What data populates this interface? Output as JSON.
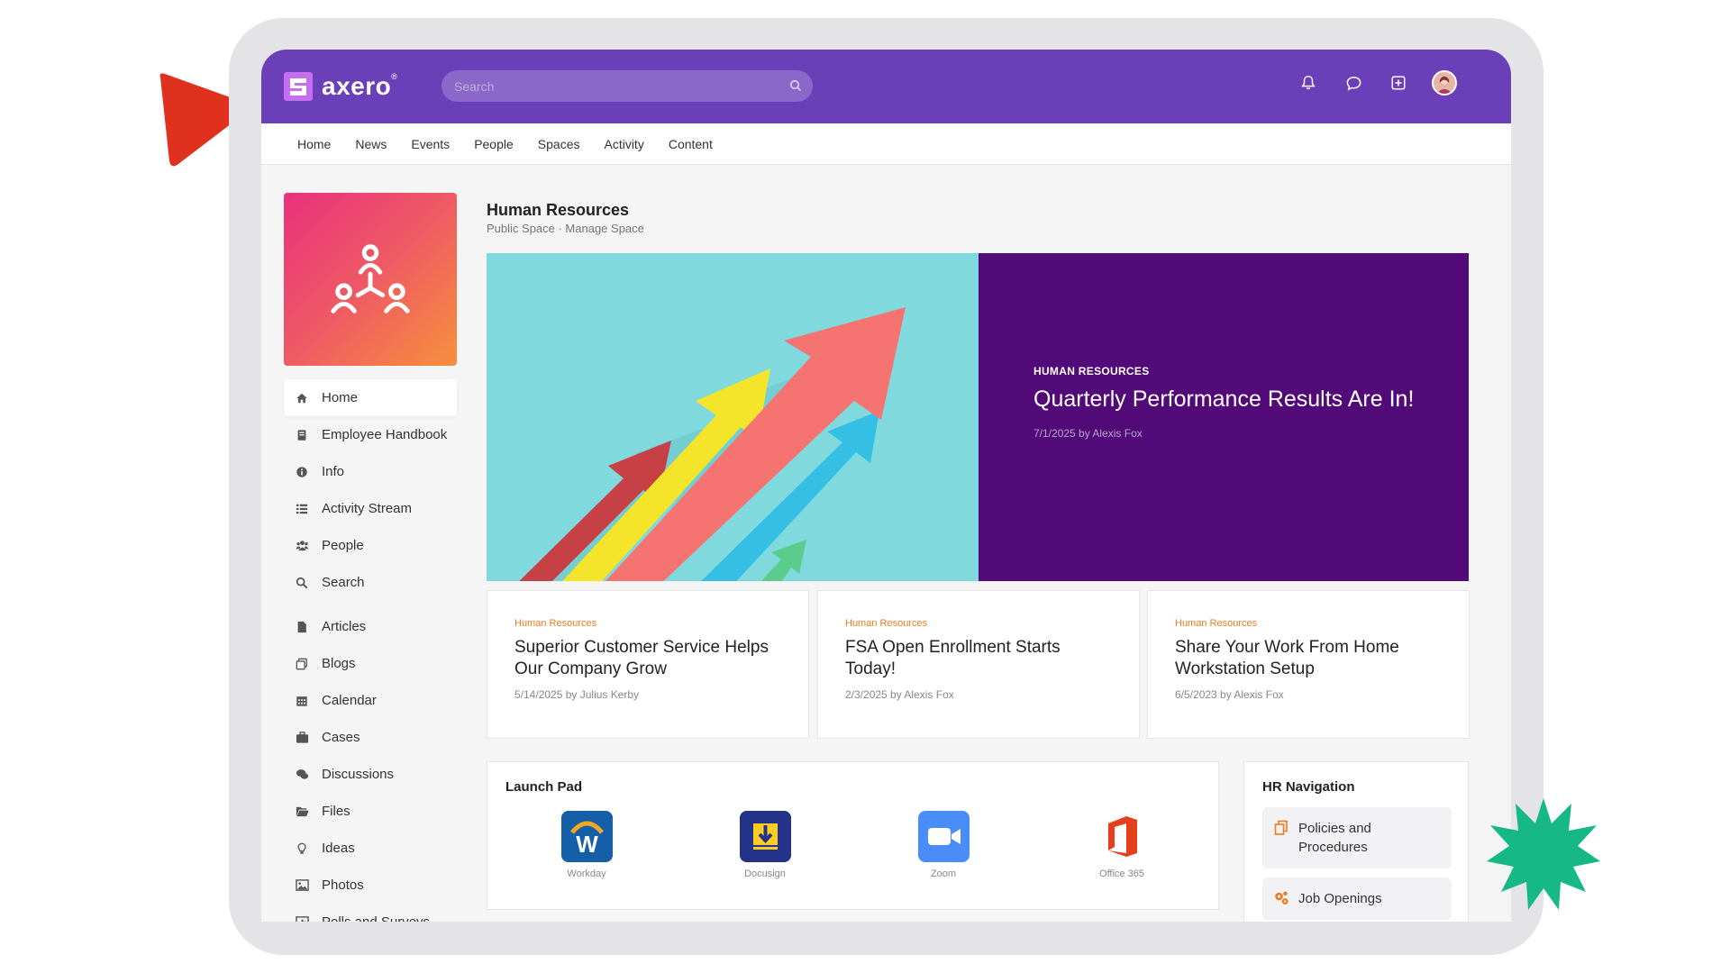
{
  "brand": {
    "name": "axero",
    "trademark": "®",
    "colors": {
      "header": "#6b3fb8",
      "hero_panel": "#520a78",
      "accent_orange": "#f07a1d",
      "arrow_red": "#e0301e",
      "star_green": "#16b985"
    }
  },
  "search": {
    "placeholder": "Search"
  },
  "top_icons": [
    "bell-icon",
    "chat-icon",
    "add-square-icon",
    "user-avatar"
  ],
  "nav": [
    "Home",
    "News",
    "Events",
    "People",
    "Spaces",
    "Activity",
    "Content"
  ],
  "space": {
    "title": "Human Resources",
    "subtitle": "Public Space · Manage Space"
  },
  "sidebar": {
    "items": [
      {
        "label": "Home",
        "icon": "home-icon",
        "active": true
      },
      {
        "label": "Employee Handbook",
        "icon": "book-icon"
      },
      {
        "label": "Info",
        "icon": "info-icon"
      },
      {
        "label": "Activity Stream",
        "icon": "list-icon"
      },
      {
        "label": "People",
        "icon": "users-icon"
      },
      {
        "label": "Search",
        "icon": "search-icon"
      }
    ],
    "items2": [
      {
        "label": "Articles",
        "icon": "file-icon"
      },
      {
        "label": "Blogs",
        "icon": "blog-icon"
      },
      {
        "label": "Calendar",
        "icon": "calendar-icon"
      },
      {
        "label": "Cases",
        "icon": "briefcase-icon"
      },
      {
        "label": "Discussions",
        "icon": "comments-icon"
      },
      {
        "label": "Files",
        "icon": "folder-icon"
      },
      {
        "label": "Ideas",
        "icon": "lightbulb-icon"
      },
      {
        "label": "Photos",
        "icon": "image-icon"
      },
      {
        "label": "Polls and Surveys",
        "icon": "bar-chart-icon"
      }
    ]
  },
  "hero": {
    "tag": "HUMAN RESOURCES",
    "title": "Quarterly Performance Results Are In!",
    "meta": "7/1/2025 by Alexis Fox"
  },
  "cards": [
    {
      "tag": "Human Resources",
      "title": "Superior Customer Service Helps Our Company Grow",
      "meta": "5/14/2025 by Julius Kerby"
    },
    {
      "tag": "Human Resources",
      "title": "FSA Open Enrollment Starts Today!",
      "meta": "2/3/2025 by Alexis Fox"
    },
    {
      "tag": "Human Resources",
      "title": "Share Your Work From Home Workstation Setup",
      "meta": "6/5/2023 by Alexis Fox"
    }
  ],
  "launch_pad": {
    "title": "Launch Pad",
    "apps": [
      {
        "name": "Workday",
        "icon": "workday-icon"
      },
      {
        "name": "Docusign",
        "icon": "docusign-icon"
      },
      {
        "name": "Zoom",
        "icon": "zoom-icon"
      },
      {
        "name": "Office 365",
        "icon": "office-icon"
      }
    ]
  },
  "hr_navigation": {
    "title": "HR Navigation",
    "items": [
      {
        "label": "Policies and Procedures",
        "icon": "documents-icon"
      },
      {
        "label": "Job Openings",
        "icon": "gears-icon"
      }
    ]
  }
}
